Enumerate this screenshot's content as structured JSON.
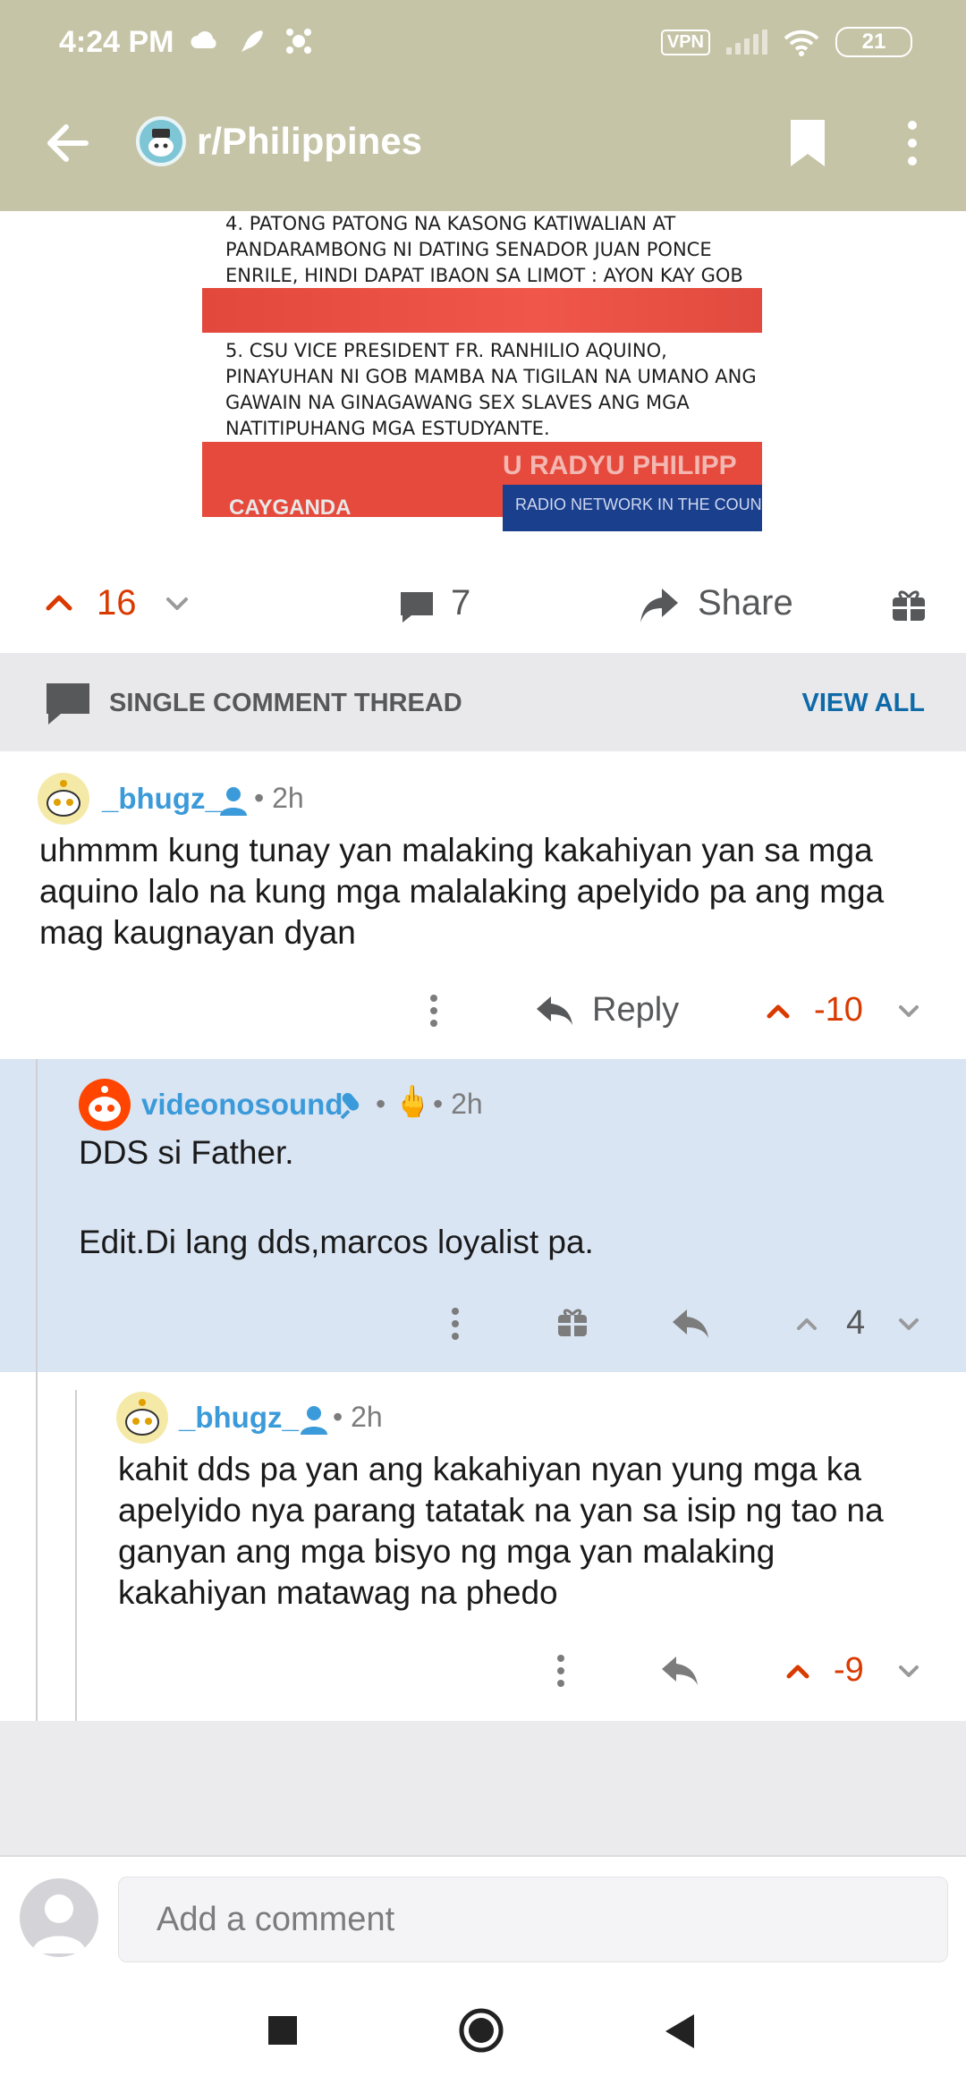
{
  "status_bar": {
    "time": "4:24 PM",
    "vpn": "VPN",
    "battery": "21"
  },
  "app_bar": {
    "subreddit": "r/Philippines"
  },
  "post_image": {
    "text_item4": "4. PATONG PATONG NA KASONG KATIWALIAN AT PANDARAMBONG NI DATING SENADOR JUAN PONCE ENRILE, HINDI DAPAT IBAON SA LIMOT : AYON KAY GOB MAMBA",
    "text_item5": "5. CSU VICE PRESIDENT FR. RANHILIO AQUINO, PINAYUHAN NI GOB MAMBA NA TIGILAN NA UMANO ANG GAWAIN NA GINAGAWANG SEX SLAVES ANG MGA NATITIPUHANG MGA ESTUDYANTE.",
    "brand": "CAYGANDA",
    "radio_top": "U RADYU PHILIPP",
    "radio": "RADIO NETWORK IN THE COUN"
  },
  "post_actions": {
    "score": "16",
    "comments": "7",
    "share_label": "Share"
  },
  "thread_header": {
    "label": "SINGLE COMMENT THREAD",
    "view_all": "VIEW ALL"
  },
  "comments": [
    {
      "username": "_bhugz_",
      "meta": "• 2h",
      "body": "uhmmm kung tunay yan malaking kakahiyan yan sa mga aquino lalo na kung mga malalaking apelyido pa ang mga mag kaugnayan dyan",
      "reply_label": "Reply",
      "score": "-10"
    },
    {
      "username": "videonosound",
      "meta_dot": "•",
      "flair": "🖕",
      "meta": "• 2h",
      "body_line1": "DDS si Father.",
      "body_line2": "Edit.Di lang dds,marcos loyalist pa.",
      "score": "4"
    },
    {
      "username": "_bhugz_",
      "meta": "• 2h",
      "body": "kahit dds pa yan ang kakahiyan nyan yung mga ka apelyido nya parang tatatak na yan sa isip ng tao na ganyan ang mga bisyo ng mga yan malaking kakahiyan matawag na phedo",
      "score": "-9"
    }
  ],
  "composer": {
    "placeholder": "Add a comment"
  },
  "colors": {
    "app_bar": "#c6c4a6",
    "upvote": "#d93a00",
    "username": "#3b9ad9",
    "highlight_bg": "#dae5f3",
    "link": "#0e6aa8"
  }
}
